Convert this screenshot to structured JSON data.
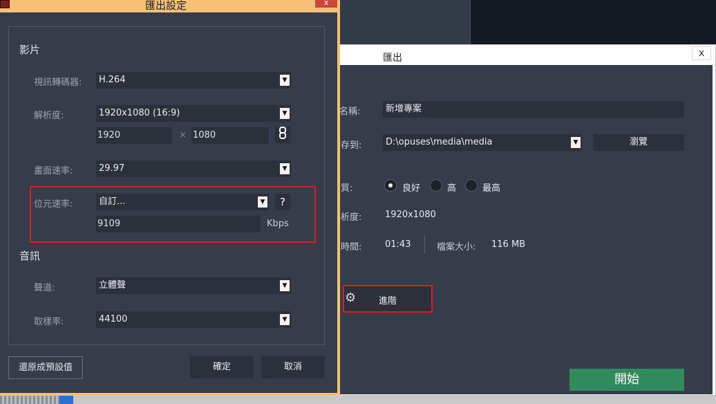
{
  "colors": {
    "accent_orange": "#f6c177",
    "highlight_red": "#e01d1d",
    "start_green": "#2f8a5c",
    "panel_dark": "#363c4a",
    "field_dark": "#2b303b"
  },
  "settings_dialog": {
    "title": "匯出設定",
    "close_label": "x",
    "video": {
      "section_title": "影片",
      "codec_label": "視訊轉碼器:",
      "codec_value": "H.264",
      "resolution_label": "解析度:",
      "resolution_value": "1920x1080 (16:9)",
      "width_value": "1920",
      "times_sign": "×",
      "height_value": "1080",
      "link_icon": "chain-link-icon",
      "framerate_label": "畫面速率:",
      "framerate_value": "29.97",
      "bitrate_label": "位元速率:",
      "bitrate_value": "自訂...",
      "bitrate_help": "?",
      "bitrate_number": "9109",
      "bitrate_unit": "Kbps"
    },
    "audio": {
      "section_title": "音訊",
      "channel_label": "聲道:",
      "channel_value": "立體聲",
      "samplerate_label": "取樣率:",
      "samplerate_value": "44100"
    },
    "buttons": {
      "reset": "還原成預設值",
      "ok": "確定",
      "cancel": "取消"
    }
  },
  "export_window": {
    "title": "匯出",
    "close_label": "x",
    "filename_label": "檔案名稱:",
    "filename_value": "新增專案",
    "saveto_label": "儲存到:",
    "saveto_value": "D:\\opuses\\media\\media",
    "browse_label": "瀏覽",
    "quality_label": "品質:",
    "quality_options": [
      "良好",
      "高",
      "最高"
    ],
    "quality_selected": "良好",
    "resolution_label": "解析度:",
    "resolution_value": "1920x1080",
    "duration_label": "總時間:",
    "duration_value": "01:43",
    "filesize_label": "檔案大小:",
    "filesize_value": "116 MB",
    "advanced_label": "進階",
    "advanced_icon": "gear-icon",
    "start_label": "開始"
  }
}
